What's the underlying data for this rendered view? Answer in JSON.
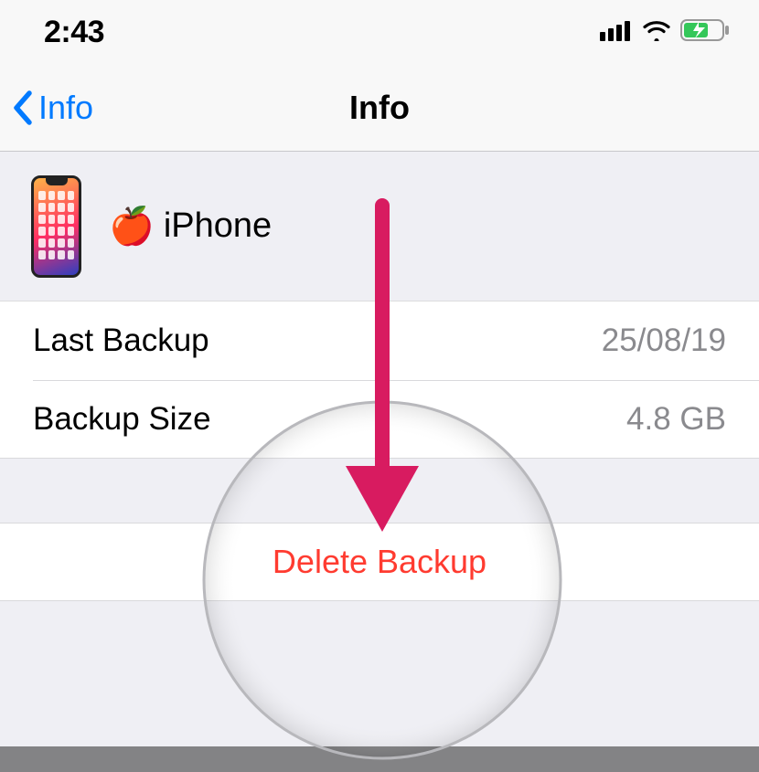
{
  "status": {
    "time": "2:43"
  },
  "nav": {
    "back_label": "Info",
    "title": "Info"
  },
  "device": {
    "emoji": "🍎",
    "name": "iPhone"
  },
  "rows": {
    "last_backup": {
      "label": "Last Backup",
      "value": "25/08/19"
    },
    "backup_size": {
      "label": "Backup Size",
      "value": "4.8 GB"
    }
  },
  "actions": {
    "delete_label": "Delete Backup"
  },
  "colors": {
    "tint": "#007aff",
    "destructive": "#ff3b30",
    "annotation": "#d81b60",
    "battery_fill": "#34c759"
  }
}
